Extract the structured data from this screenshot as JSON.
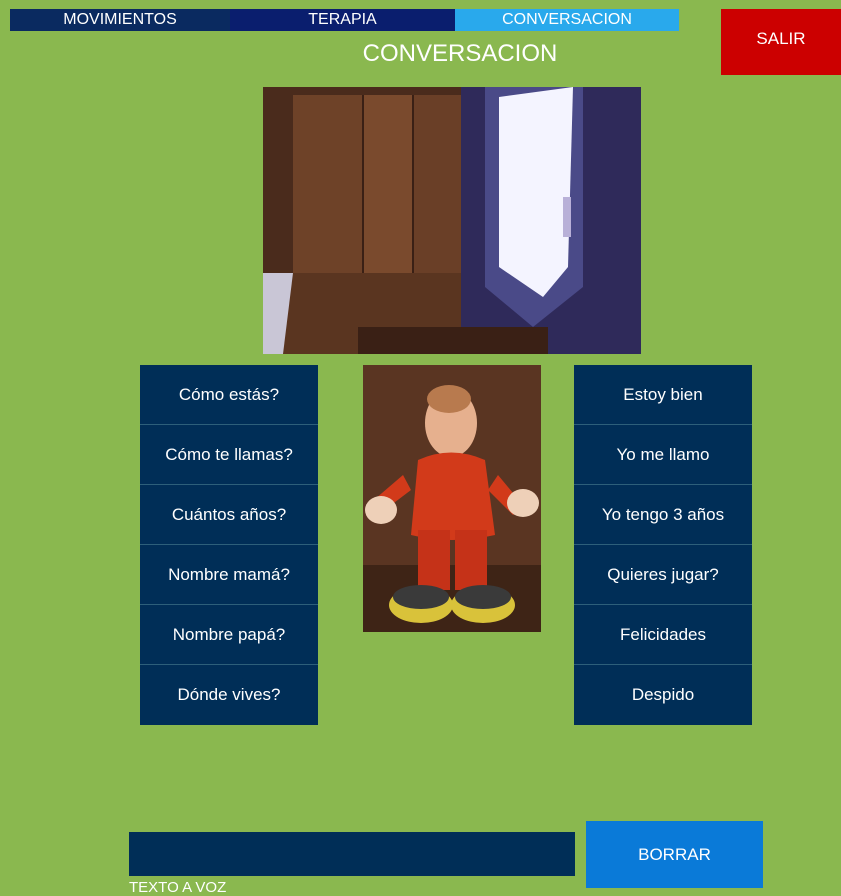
{
  "tabs": [
    {
      "label": "MOVIMIENTOS"
    },
    {
      "label": "TERAPIA"
    },
    {
      "label": "CONVERSACION"
    }
  ],
  "exit_label": "SALIR",
  "page_title": "CONVERSACION",
  "questions": [
    "Cómo estás?",
    "Cómo te llamas?",
    "Cuántos años?",
    "Nombre mamá?",
    "Nombre papá?",
    "Dónde vives?"
  ],
  "answers": [
    "Estoy bien",
    "Yo me llamo",
    "Yo tengo 3 años",
    "Quieres jugar?",
    "Felicidades",
    "Despido"
  ],
  "tts": {
    "value": "",
    "label": "TEXTO A VOZ"
  },
  "clear_label": "BORRAR",
  "colors": {
    "background": "#8ab84f",
    "tab_movimientos": "#0a2a60",
    "tab_terapia": "#0a1e6e",
    "tab_active": "#29a9ec",
    "exit": "#cc0000",
    "phrase_button": "#002e57",
    "clear_button": "#0a7ad8"
  }
}
